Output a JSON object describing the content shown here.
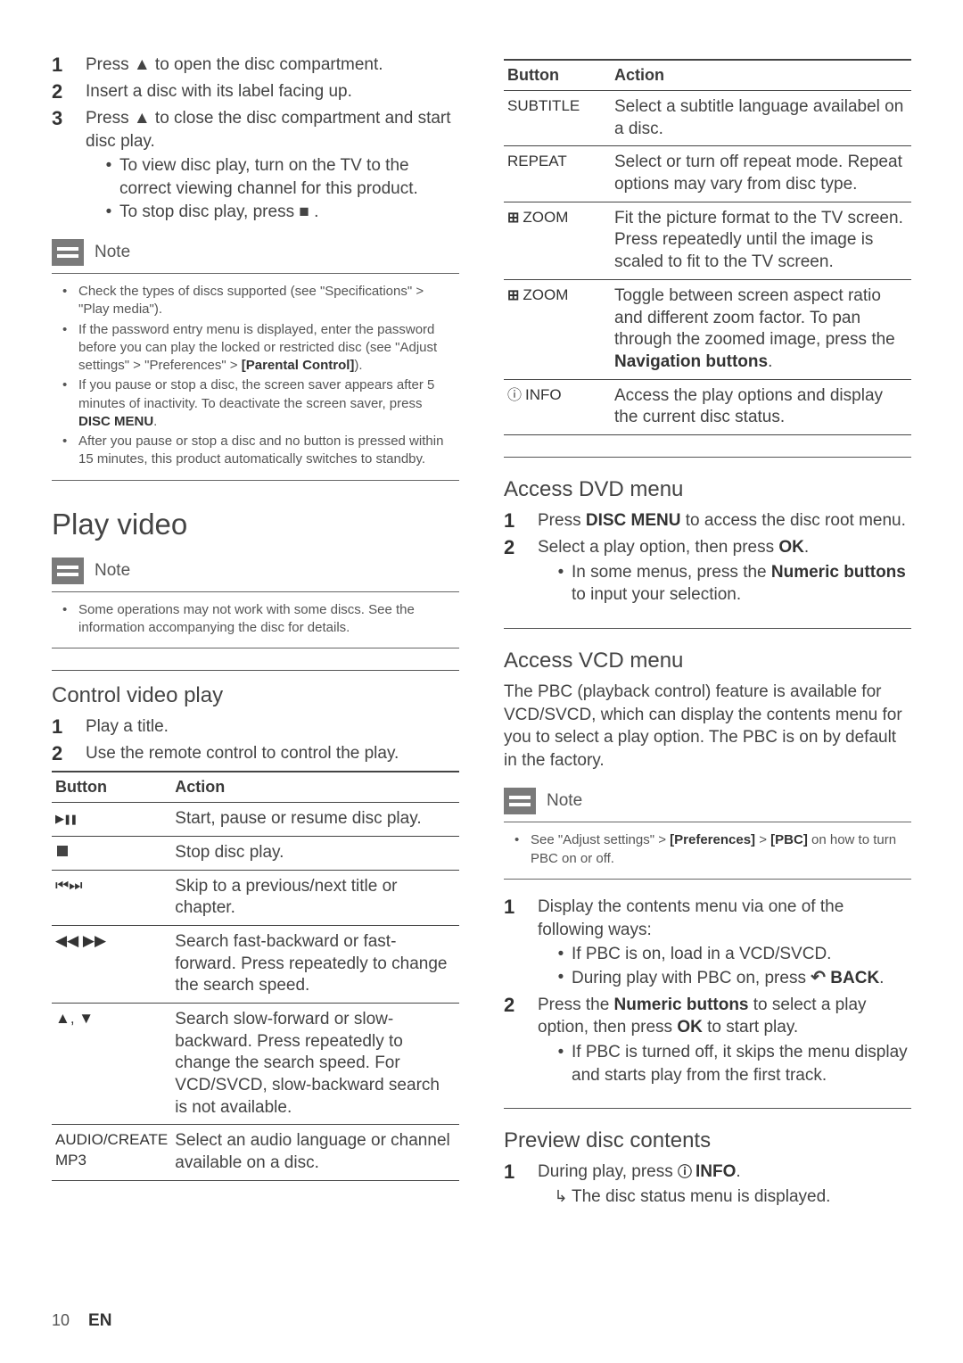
{
  "left": {
    "steps1": {
      "s1": {
        "num": "1",
        "text": "Press ▲ to open the disc compartment."
      },
      "s2": {
        "num": "2",
        "text": "Insert a disc with its label facing up."
      },
      "s3": {
        "num": "3",
        "text": "Press ▲ to close the disc compartment and start disc play.",
        "b1": "To view disc play, turn on the TV to the correct viewing channel for this product.",
        "b2": "To stop disc play, press ■ ."
      }
    },
    "note1": {
      "title": "Note",
      "i1": "Check the types of discs supported (see \"Specifications\" > \"Play media\").",
      "i2a": "If the password entry menu is displayed, enter the password before you can play the locked or restricted disc (see \"Adjust settings\" > \"Preferences\" > ",
      "i2b": "[Parental Control]",
      "i2c": ").",
      "i3a": "If you pause or stop a disc, the screen saver appears after 5 minutes of inactivity. To deactivate the screen saver, press ",
      "i3b": "DISC MENU",
      "i3c": ".",
      "i4": "After you pause or stop a disc and no button is pressed within 15 minutes, this product automatically switches to standby."
    },
    "h1_play_video": "Play video",
    "note2": {
      "title": "Note",
      "i1": "Some operations may not work with some discs. See the information accompanying the disc for details."
    },
    "h2_control": "Control video play",
    "steps2": {
      "s1": {
        "num": "1",
        "text": "Play a title."
      },
      "s2": {
        "num": "2",
        "text": "Use the remote control to control the play."
      }
    },
    "table1": {
      "h_button": "Button",
      "h_action": "Action",
      "r1": {
        "btn": "play-pause",
        "act": "Start, pause or resume disc play."
      },
      "r2": {
        "btn": "stop",
        "act": "Stop disc play."
      },
      "r3": {
        "btn": "prev-next",
        "act": "Skip to a previous/next title or chapter."
      },
      "r4": {
        "btn": "rew-ff",
        "act": "Search fast-backward or fast-forward. Press repeatedly to change the search speed."
      },
      "r5": {
        "btn": "up-down",
        "act": "Search slow-forward or slow-backward. Press repeatedly to change the search speed. For VCD/SVCD, slow-backward search is not available."
      },
      "r6": {
        "btn": "AUDIO/CREATE MP3",
        "act": "Select an audio language or channel available on a disc."
      }
    }
  },
  "right": {
    "table2": {
      "h_button": "Button",
      "h_action": "Action",
      "r1": {
        "btn": "SUBTITLE",
        "act": "Select a subtitle language availabel on a disc."
      },
      "r2": {
        "btn": "REPEAT",
        "act": "Select or turn off repeat mode. Repeat options may vary from disc type."
      },
      "r3": {
        "btn": "ZOOM",
        "act": "Fit the picture format to the TV screen. Press repeatedly until the image is scaled to fit to the TV screen."
      },
      "r4": {
        "btn": "ZOOM",
        "act_a": "Toggle between screen aspect ratio and different zoom factor. To pan through the zoomed image, press the ",
        "act_b": "Navigation buttons",
        "act_c": "."
      },
      "r5": {
        "btn": "INFO",
        "act": "Access the play options and display the current disc status."
      }
    },
    "h2_dvd": "Access DVD menu",
    "dvd_steps": {
      "s1": {
        "num": "1",
        "text_a": "Press ",
        "text_b": "DISC MENU",
        "text_c": " to access the disc root menu."
      },
      "s2": {
        "num": "2",
        "text_a": "Select a play option, then press ",
        "text_b": "OK",
        "text_c": ".",
        "b1_a": "In some menus, press the ",
        "b1_b": "Numeric buttons",
        "b1_c": " to input your selection."
      }
    },
    "h2_vcd": "Access VCD menu",
    "vcd_intro": "The PBC (playback control) feature is available for VCD/SVCD, which can display the contents menu for you to select a play option. The PBC is on by default in the factory.",
    "note3": {
      "title": "Note",
      "i1_a": "See \"Adjust settings\" > ",
      "i1_b": "[Preferences]",
      "i1_c": " > ",
      "i1_d": "[PBC]",
      "i1_e": " on how to turn PBC on or off."
    },
    "vcd_steps": {
      "s1": {
        "num": "1",
        "text": "Display the contents menu via one of the following ways:",
        "b1": "If PBC is on, load in a VCD/SVCD.",
        "b2_a": "During play with PBC on, press ",
        "b2_b": "BACK",
        "b2_c": "."
      },
      "s2": {
        "num": "2",
        "text_a": "Press the ",
        "text_b": "Numeric buttons",
        "text_c": " to select a play option, then press ",
        "text_d": "OK",
        "text_e": " to start play.",
        "b1": "If PBC is turned off, it skips the menu display and starts play from the first track."
      }
    },
    "h2_preview": "Preview disc contents",
    "prev_steps": {
      "s1": {
        "num": "1",
        "text_a": "During play, press ",
        "text_b": "INFO",
        "text_c": ".",
        "b1": "The disc status menu is displayed."
      }
    }
  },
  "footer": {
    "page": "10",
    "lang": "EN"
  }
}
